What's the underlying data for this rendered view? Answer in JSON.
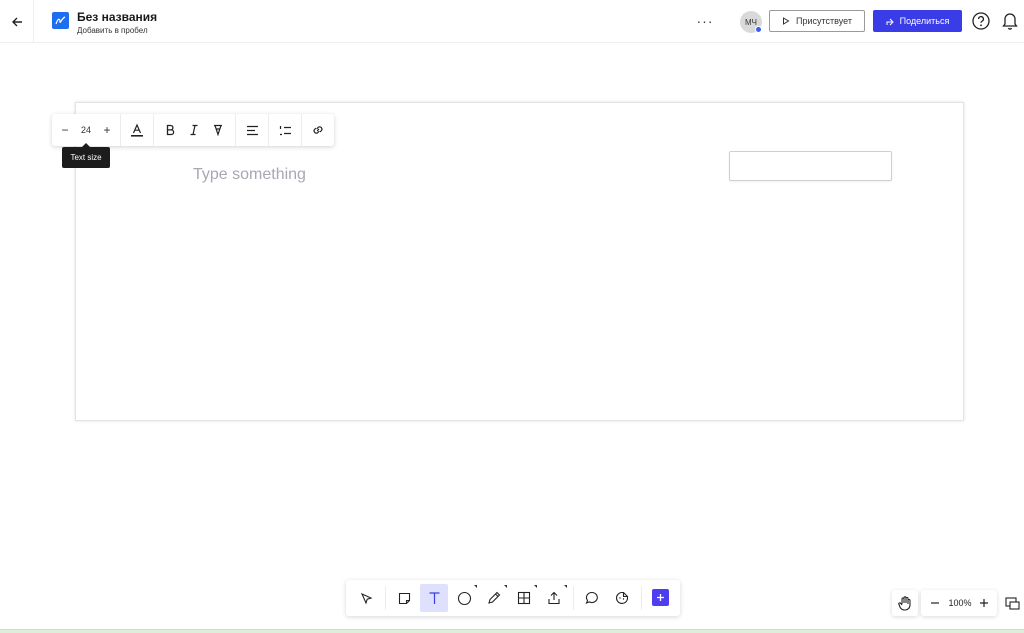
{
  "header": {
    "back_icon": "arrow-left-icon",
    "logo_icon": "whiteboard-logo-icon",
    "title": "Без названия",
    "subtitle": "Добавить в пробел",
    "more_icon": "ellipsis-icon",
    "more_label": "···",
    "avatar_initials": "МЧ",
    "present_label": "Присутствует",
    "present_icon": "play-icon",
    "share_label": "Поделиться",
    "share_icon": "share-icon",
    "help_icon": "help-circle-icon",
    "notifications_icon": "bell-icon",
    "accent_color": "#3a3ce8"
  },
  "text_toolbar": {
    "decrease_label": "−",
    "font_size": "24",
    "increase_label": "+",
    "tooltip": "Text size",
    "tools": [
      "text-color-icon",
      "bold-icon",
      "italic-icon",
      "highlight-icon",
      "align-left-icon",
      "numbered-list-icon",
      "link-icon"
    ]
  },
  "canvas": {
    "text_placeholder": "Type something"
  },
  "bottom_toolbar": {
    "tools": [
      "select-icon",
      "sticky-note-icon",
      "text-icon",
      "shape-icon",
      "pen-icon",
      "table-icon",
      "upload-icon",
      "comment-icon",
      "sticker-icon",
      "add-icon"
    ],
    "active_tool": "text-icon"
  },
  "zoom": {
    "hand_icon": "hand-icon",
    "minus_label": "−",
    "level": "100%",
    "plus_label": "+",
    "map_icon": "minimap-icon"
  }
}
